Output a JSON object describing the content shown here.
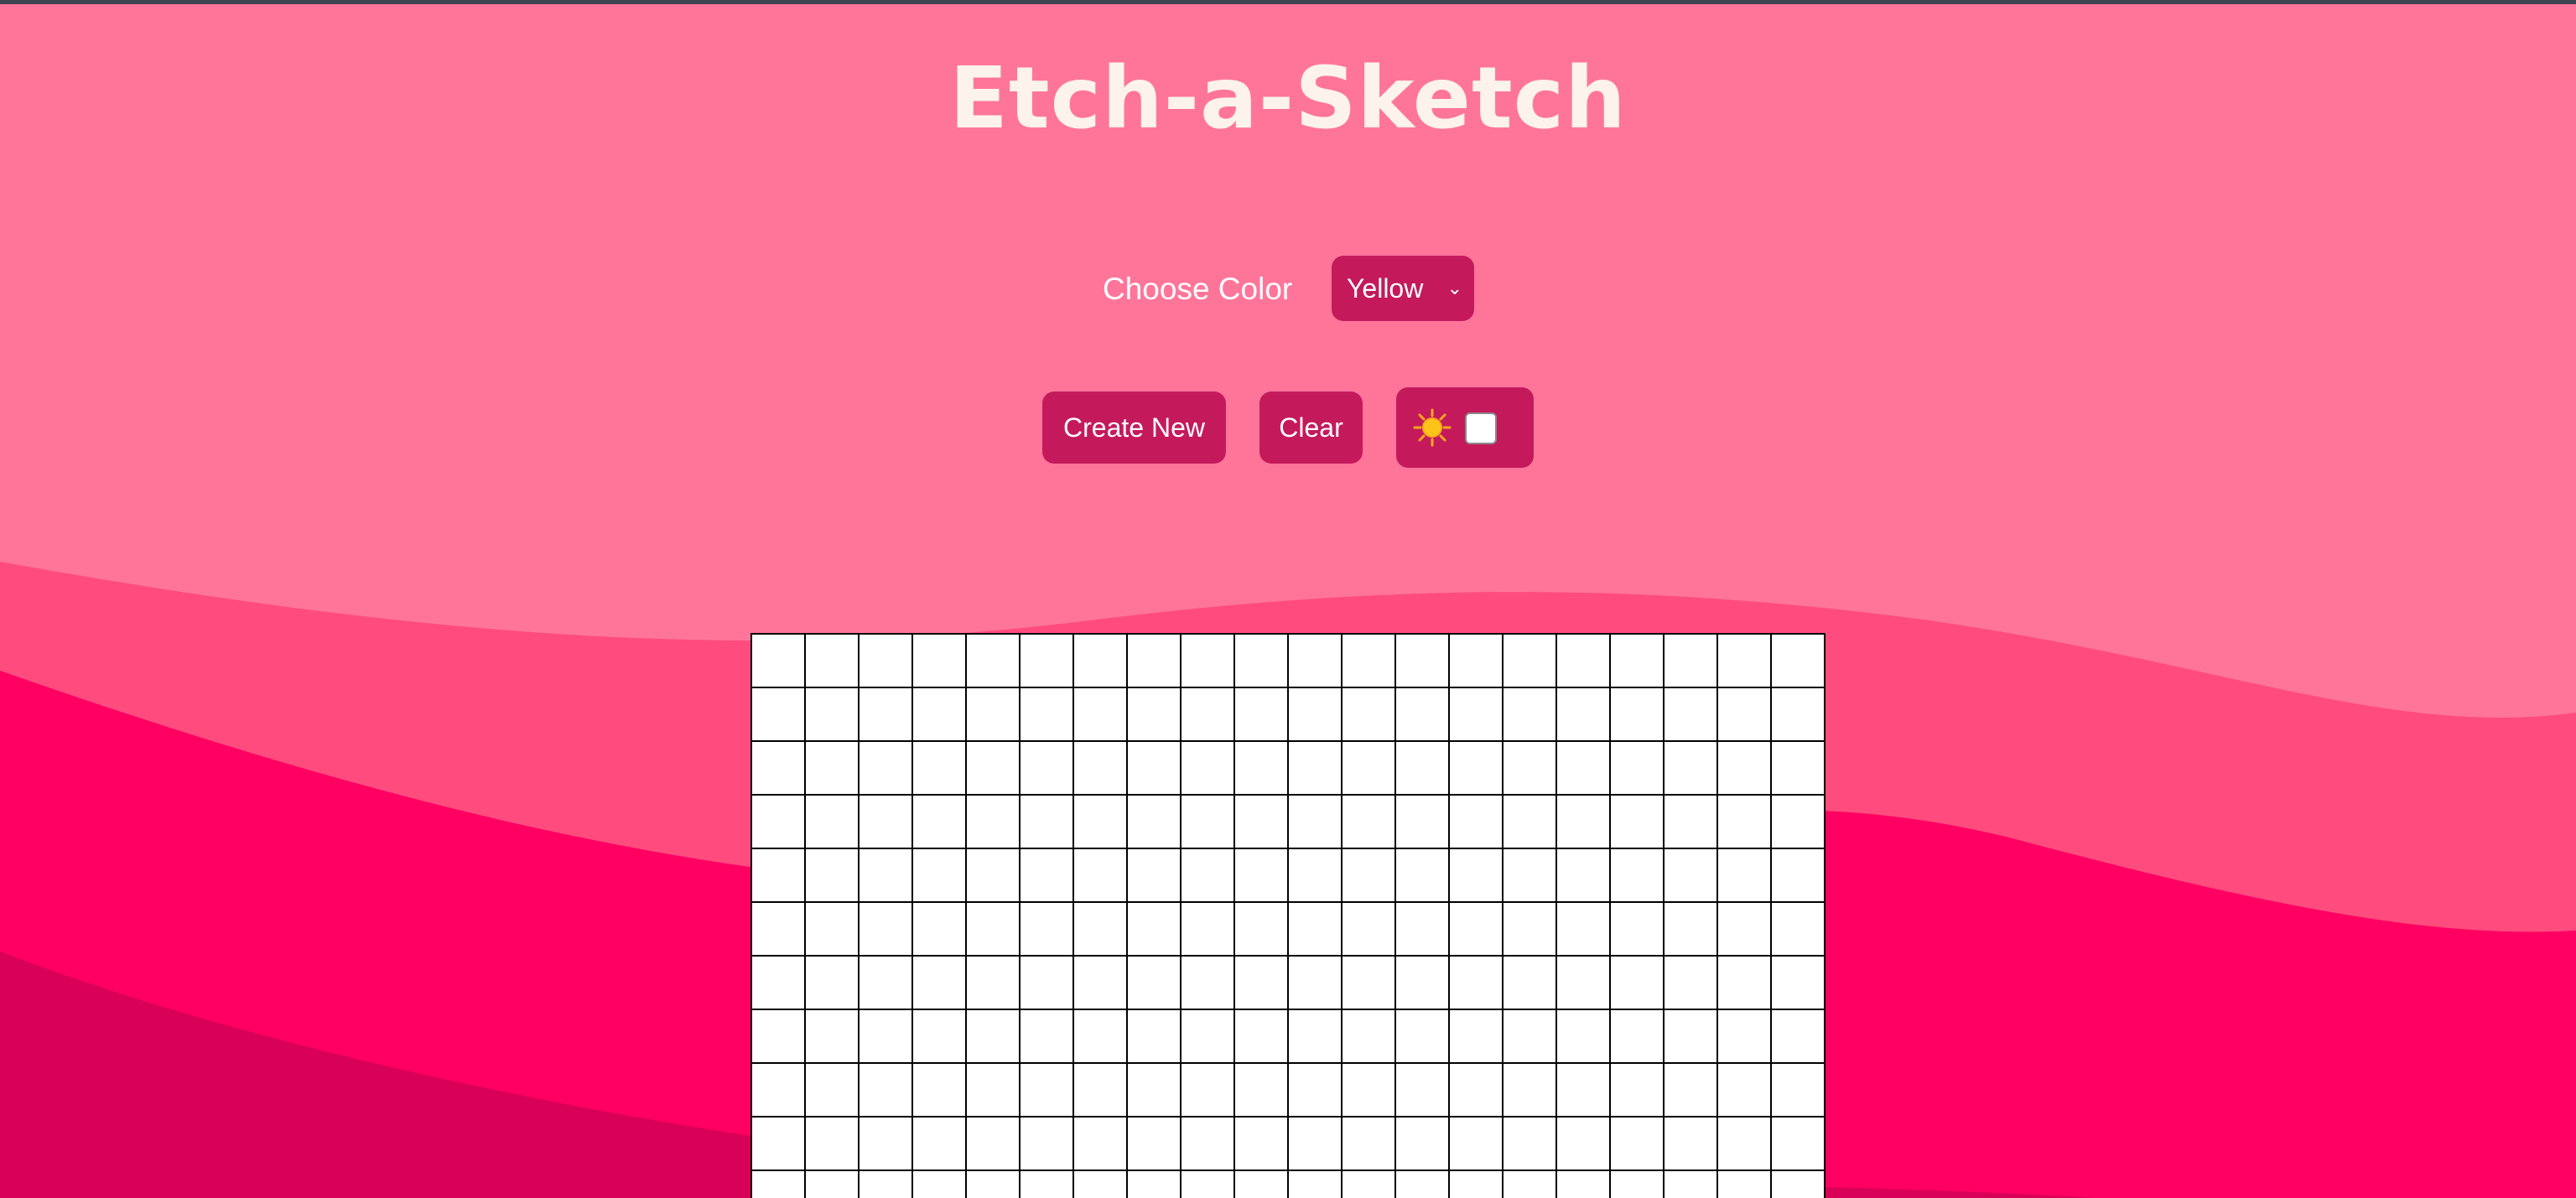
{
  "app": {
    "title": "Etch-a-Sketch"
  },
  "controls": {
    "color_label": "Choose Color",
    "color_select": {
      "selected": "Yellow"
    },
    "create_new_label": "Create New",
    "clear_label": "Clear",
    "mode_toggle": {
      "icon": "sun-icon",
      "checked": false
    }
  },
  "grid": {
    "columns": 20,
    "cell_color": "#ffffff",
    "line_color": "#000000"
  },
  "colors": {
    "background": "#ff759a",
    "wave_mid": "#ff4b7e",
    "wave_bright": "#ff0062",
    "wave_dark": "#d90057",
    "button": "#c41a5c",
    "title": "#fdf2ec"
  }
}
